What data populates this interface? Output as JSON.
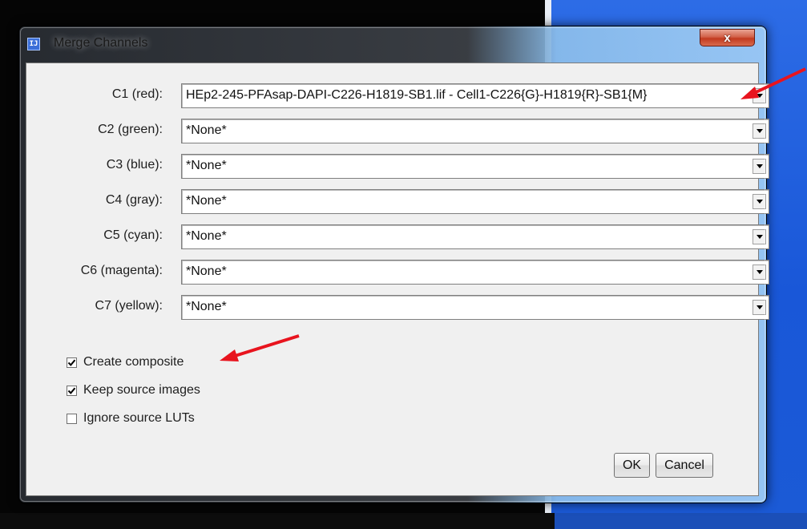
{
  "window": {
    "title": "Merge Channels",
    "close_glyph": "x"
  },
  "channels": [
    {
      "label": "C1 (red):",
      "value": "HEp2-245-PFAsap-DAPI-C226-H1819-SB1.lif - Cell1-C226{G}-H1819{R}-SB1{M}"
    },
    {
      "label": "C2 (green):",
      "value": "*None*"
    },
    {
      "label": "C3 (blue):",
      "value": "*None*"
    },
    {
      "label": "C4 (gray):",
      "value": "*None*"
    },
    {
      "label": "C5 (cyan):",
      "value": "*None*"
    },
    {
      "label": "C6 (magenta):",
      "value": "*None*"
    },
    {
      "label": "C7 (yellow):",
      "value": "*None*"
    }
  ],
  "options": [
    {
      "label": "Create composite",
      "checked": true
    },
    {
      "label": "Keep source images",
      "checked": true
    },
    {
      "label": "Ignore source LUTs",
      "checked": false
    }
  ],
  "buttons": {
    "ok": "OK",
    "cancel": "Cancel"
  },
  "colors": {
    "annotation_arrow": "#e8141e",
    "titlebar_close": "#c23a1f",
    "dialog_bg": "#f0f0f0"
  },
  "icons": {
    "app": "imagej-icon",
    "dropdown": "chevron-down-icon",
    "check": "checkmark-icon"
  }
}
